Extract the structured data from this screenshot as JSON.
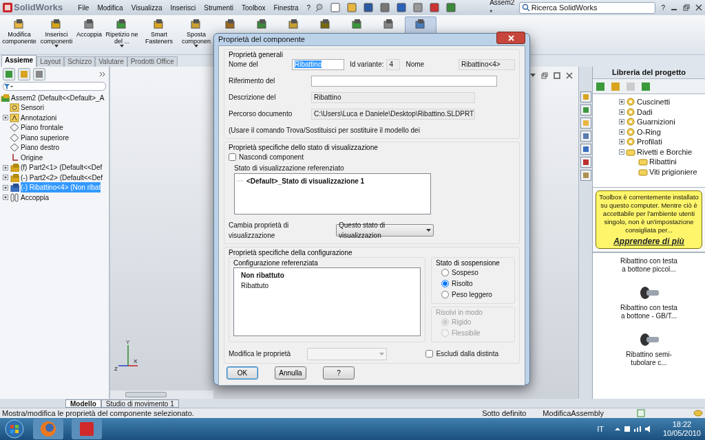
{
  "app": {
    "logo": "SolidWorks",
    "menu": [
      "File",
      "Modifica",
      "Visualizza",
      "Inserisci",
      "Strumenti",
      "Toolbox",
      "Finestra",
      "?"
    ],
    "document_title": "Assem2 *",
    "search": {
      "placeholder": "Ricerca SolidWorks"
    },
    "help": "?"
  },
  "command_manager": [
    {
      "kind": "labeled",
      "label": "Modifica componente",
      "dropdown": false,
      "active": false
    },
    {
      "kind": "labeled",
      "label": "Inserisci componenti",
      "dropdown": true,
      "active": false
    },
    {
      "kind": "labeled",
      "label": "Accoppia",
      "dropdown": false,
      "active": false
    },
    {
      "kind": "labeled",
      "label": "Ripetizio ne del ...",
      "dropdown": true,
      "active": false
    },
    {
      "kind": "labeled",
      "label": "Smart Fasteners",
      "dropdown": false,
      "active": false
    },
    {
      "kind": "labeled",
      "label": "Sposta componen",
      "dropdown": true,
      "active": false
    },
    {
      "kind": "icon",
      "active": false
    },
    {
      "kind": "icon",
      "active": false
    },
    {
      "kind": "icon",
      "active": false
    },
    {
      "kind": "icon",
      "active": false
    },
    {
      "kind": "icon",
      "active": false
    },
    {
      "kind": "icon",
      "active": false
    },
    {
      "kind": "icon",
      "active": true
    }
  ],
  "tabs": [
    {
      "label": "Assieme",
      "selected": true
    },
    {
      "label": "Layout",
      "selected": false
    },
    {
      "label": "Schizzo",
      "selected": false
    },
    {
      "label": "Valutare",
      "selected": false
    },
    {
      "label": "Prodotti Office",
      "selected": false
    }
  ],
  "feature_tree": {
    "root": "Assem2  (Default<<Default>_A",
    "items": [
      {
        "kind": "sensor",
        "label": "Sensori",
        "selected": false
      },
      {
        "kind": "annotation",
        "label": "Annotazioni",
        "expanded": false,
        "selected": false
      },
      {
        "kind": "plane",
        "label": "Piano frontale",
        "selected": false
      },
      {
        "kind": "plane",
        "label": "Piano superiore",
        "selected": false
      },
      {
        "kind": "plane",
        "label": "Piano destro",
        "selected": false
      },
      {
        "kind": "origin",
        "label": "Origine",
        "selected": false
      },
      {
        "kind": "part",
        "label": "(f) Part2<1>  (Default<<Def",
        "expanded": false,
        "selected": false
      },
      {
        "kind": "part",
        "label": "(-) Part2<2>  (Default<<Def",
        "expanded": false,
        "selected": false
      },
      {
        "kind": "subpart",
        "label": "(-) Ribattino<4>  (Non ribat",
        "expanded": false,
        "selected": true
      },
      {
        "kind": "mate",
        "label": "Accoppia",
        "expanded": false,
        "selected": false
      }
    ]
  },
  "triad_labels": [
    "Y",
    "X",
    "Z"
  ],
  "bottom_tabs": [
    {
      "label": "Modello",
      "selected": true
    },
    {
      "label": "Studio di movimento 1",
      "selected": false
    }
  ],
  "library": {
    "title": "Libreria del progetto",
    "tree": [
      {
        "label": "Cuscinetti",
        "expanded": false
      },
      {
        "label": "Dadi",
        "expanded": false
      },
      {
        "label": "Guarnizioni",
        "expanded": false
      },
      {
        "label": "O-Ring",
        "expanded": false
      },
      {
        "label": "Profilati",
        "expanded": false
      },
      {
        "label": "Rivetti e Borchie",
        "expanded": true,
        "children": [
          {
            "label": "Ribattini"
          },
          {
            "label": "Viti prigioniere"
          }
        ]
      }
    ],
    "notice": "Toolbox è correntemente installato su questo computer. Mentre ciò è accettabile per l'ambiente utenti singolo, non è un'impostazione consigliata per...",
    "notice_link": "Apprendere di più",
    "items": [
      {
        "label": "Ribattino con testa a bottone piccol...",
        "picture": false
      },
      {
        "label": "Ribattino con testa a bottone - GB/T...",
        "picture": true
      },
      {
        "label": "Ribattino semi-tubolare c...",
        "picture": true
      }
    ]
  },
  "dialog": {
    "title": "Proprietà del componente",
    "general": {
      "title": "Proprietà generali",
      "name_label": "Nome del",
      "name_value": "Ribattino",
      "variant_label": "Id variante:",
      "variant_value": "4",
      "full_name_label": "Nome",
      "full_name": "Ribattino<4>",
      "reference_label": "Riferimento del",
      "description_label": "Descrizione del",
      "description": "Ribattino",
      "path_label": "Percorso documento",
      "path": "C:\\Users\\Luca e Daniele\\Desktop\\Ribattino.SLDPRT",
      "note": "(Usare il comando Trova/Sostituisci per sostituire il modello dei"
    },
    "display": {
      "title": "Proprietà specifiche dello stato di visualizzazione",
      "hide_label": "Nascondi component",
      "hide_checked": false,
      "list_label": "Stato di visualizzazione referenziato",
      "states": [
        "<Default>_Stato di visualizzazione 1"
      ],
      "change_label": "Cambia proprietà di visualizzazione",
      "change_value": "Questo stato di visualizzazion"
    },
    "config": {
      "title": "Proprietà specifiche della configurazione",
      "list_label": "Configurazione referenziata",
      "configurations": [
        {
          "label": "Non ribattuto",
          "active": true
        },
        {
          "label": "Ribattuto",
          "active": false
        }
      ],
      "suppression": {
        "title": "Stato di sospensione",
        "options": [
          {
            "label": "Sospeso",
            "selected": false
          },
          {
            "label": "Risolto",
            "selected": true
          },
          {
            "label": "Peso leggero",
            "selected": false
          }
        ]
      },
      "solve": {
        "title": "Risolvi in modo",
        "disabled": true,
        "options": [
          {
            "label": "Rigido",
            "selected": true
          },
          {
            "label": "Flessibile",
            "selected": false
          }
        ]
      },
      "modify_label": "Modifica le proprietà",
      "exclude_label": "Escludi dalla distinta",
      "exclude_checked": false
    },
    "buttons": [
      {
        "label": "OK",
        "default": true
      },
      {
        "label": "Annulla",
        "default": false
      },
      {
        "label": "?",
        "default": false
      }
    ]
  },
  "status_bar": {
    "message": "Mostra/modifica le proprietà del componente selezionato.",
    "state": "Sotto definito",
    "mode": "ModificaAssembly"
  },
  "taskbar": {
    "language": "IT",
    "time": "18:22",
    "date": "10/05/2010"
  }
}
